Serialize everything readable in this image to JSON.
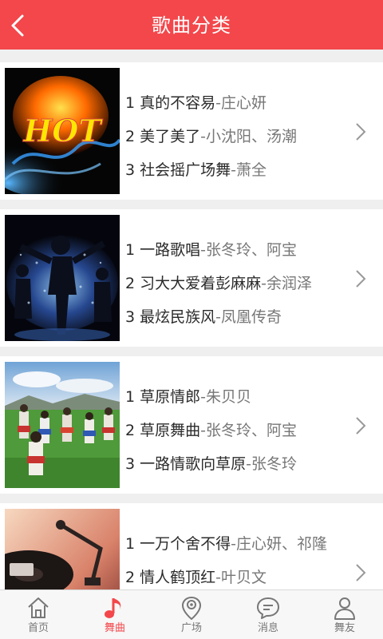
{
  "header": {
    "title": "歌曲分类"
  },
  "categories": [
    {
      "songs": [
        {
          "index": "1",
          "title": "真的不容易",
          "artist": "-庄心妍"
        },
        {
          "index": "2",
          "title": "美了美了",
          "artist": "-小沈阳、汤潮"
        },
        {
          "index": "3",
          "title": "社会摇广场舞",
          "artist": "-萧全"
        }
      ],
      "thumb_text": "HOT"
    },
    {
      "songs": [
        {
          "index": "1",
          "title": "一路歌唱",
          "artist": "-张冬玲、阿宝"
        },
        {
          "index": "2",
          "title": "习大大爱着彭麻麻",
          "artist": "-余润泽"
        },
        {
          "index": "3",
          "title": "最炫民族风",
          "artist": "-凤凰传奇"
        }
      ]
    },
    {
      "songs": [
        {
          "index": "1",
          "title": "草原情郎",
          "artist": "-朱贝贝"
        },
        {
          "index": "2",
          "title": "草原舞曲",
          "artist": "-张冬玲、阿宝"
        },
        {
          "index": "3",
          "title": "一路情歌向草原",
          "artist": "-张冬玲"
        }
      ]
    },
    {
      "songs": [
        {
          "index": "1",
          "title": "一万个舍不得",
          "artist": "-庄心妍、祁隆"
        },
        {
          "index": "2",
          "title": "情人鹤顶红",
          "artist": "-叶贝文"
        }
      ]
    }
  ],
  "tabbar": {
    "items": [
      {
        "label": "首页",
        "icon": "home-icon"
      },
      {
        "label": "舞曲",
        "icon": "music-note-icon"
      },
      {
        "label": "广场",
        "icon": "location-pin-icon"
      },
      {
        "label": "消息",
        "icon": "chat-bubble-icon"
      },
      {
        "label": "舞友",
        "icon": "person-icon"
      }
    ],
    "active_index": 1
  },
  "colors": {
    "accent": "#f3474b",
    "tab_inactive": "#777777"
  }
}
